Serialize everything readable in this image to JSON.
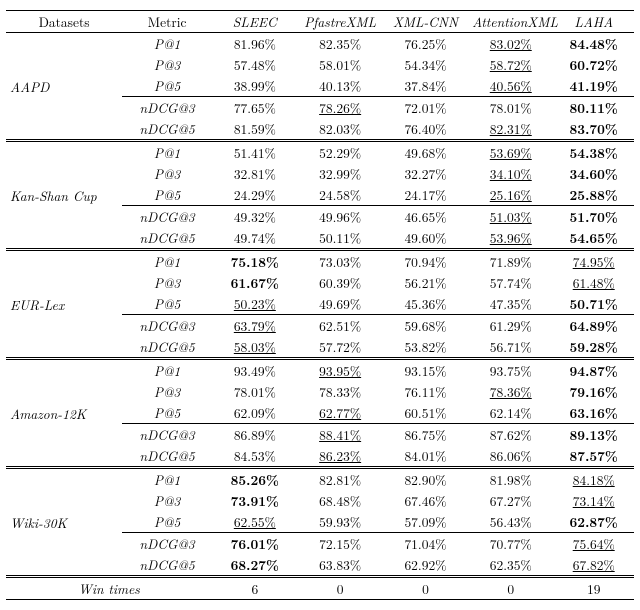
{
  "columns": {
    "datasets": "Datasets",
    "metric": "Metric",
    "models": [
      "SLEEC",
      "PfastreXML",
      "XML-CNN",
      "AttentionXML",
      "LAHA"
    ]
  },
  "footer": {
    "label": "Win times",
    "values": [
      "6",
      "0",
      "0",
      "0",
      "19"
    ]
  },
  "blocks": [
    {
      "dataset": "AAPD",
      "rows": [
        {
          "metric": "P@1",
          "cells": [
            {
              "v": "81.96%"
            },
            {
              "v": "82.35%"
            },
            {
              "v": "76.25%"
            },
            {
              "v": "83.02%",
              "u": true
            },
            {
              "v": "84.48%",
              "b": true
            }
          ]
        },
        {
          "metric": "P@3",
          "cells": [
            {
              "v": "57.48%"
            },
            {
              "v": "58.01%"
            },
            {
              "v": "54.34%"
            },
            {
              "v": "58.72%",
              "u": true
            },
            {
              "v": "60.72%",
              "b": true
            }
          ]
        },
        {
          "metric": "P@5",
          "cells": [
            {
              "v": "38.99%"
            },
            {
              "v": "40.13%"
            },
            {
              "v": "37.84%"
            },
            {
              "v": "40.56%",
              "u": true
            },
            {
              "v": "41.19%",
              "b": true
            }
          ]
        },
        {
          "metric": "nDCG@3",
          "sep": true,
          "cells": [
            {
              "v": "77.65%"
            },
            {
              "v": "78.26%",
              "u": true
            },
            {
              "v": "72.01%"
            },
            {
              "v": "78.01%"
            },
            {
              "v": "80.11%",
              "b": true
            }
          ]
        },
        {
          "metric": "nDCG@5",
          "cells": [
            {
              "v": "81.59%"
            },
            {
              "v": "82.03%"
            },
            {
              "v": "76.40%"
            },
            {
              "v": "82.31%",
              "u": true
            },
            {
              "v": "83.70%",
              "b": true
            }
          ]
        }
      ]
    },
    {
      "dataset": "Kan-Shan Cup",
      "rows": [
        {
          "metric": "P@1",
          "cells": [
            {
              "v": "51.41%"
            },
            {
              "v": "52.29%"
            },
            {
              "v": "49.68%"
            },
            {
              "v": "53.69%",
              "u": true
            },
            {
              "v": "54.38%",
              "b": true
            }
          ]
        },
        {
          "metric": "P@3",
          "cells": [
            {
              "v": "32.81%"
            },
            {
              "v": "32.99%"
            },
            {
              "v": "32.27%"
            },
            {
              "v": "34.10%",
              "u": true
            },
            {
              "v": "34.60%",
              "b": true
            }
          ]
        },
        {
          "metric": "P@5",
          "cells": [
            {
              "v": "24.29%"
            },
            {
              "v": "24.58%"
            },
            {
              "v": "24.17%"
            },
            {
              "v": "25.16%",
              "u": true
            },
            {
              "v": "25.88%",
              "b": true
            }
          ]
        },
        {
          "metric": "nDCG@3",
          "sep": true,
          "cells": [
            {
              "v": "49.32%"
            },
            {
              "v": "49.96%"
            },
            {
              "v": "46.65%"
            },
            {
              "v": "51.03%",
              "u": true
            },
            {
              "v": "51.70%",
              "b": true
            }
          ]
        },
        {
          "metric": "nDCG@5",
          "cells": [
            {
              "v": "49.74%"
            },
            {
              "v": "50.11%"
            },
            {
              "v": "49.60%"
            },
            {
              "v": "53.96%",
              "u": true
            },
            {
              "v": "54.65%",
              "b": true
            }
          ]
        }
      ]
    },
    {
      "dataset": "EUR-Lex",
      "rows": [
        {
          "metric": "P@1",
          "cells": [
            {
              "v": "75.18%",
              "b": true
            },
            {
              "v": "73.03%"
            },
            {
              "v": "70.94%"
            },
            {
              "v": "71.89%"
            },
            {
              "v": "74.95%",
              "u": true
            }
          ]
        },
        {
          "metric": "P@3",
          "cells": [
            {
              "v": "61.67%",
              "b": true
            },
            {
              "v": "60.39%"
            },
            {
              "v": "56.21%"
            },
            {
              "v": "57.74%"
            },
            {
              "v": "61.48%",
              "u": true
            }
          ]
        },
        {
          "metric": "P@5",
          "cells": [
            {
              "v": "50.23%",
              "u": true
            },
            {
              "v": "49.69%"
            },
            {
              "v": "45.36%"
            },
            {
              "v": "47.35%"
            },
            {
              "v": "50.71%",
              "b": true
            }
          ]
        },
        {
          "metric": "nDCG@3",
          "sep": true,
          "cells": [
            {
              "v": "63.79%",
              "u": true
            },
            {
              "v": "62.51%"
            },
            {
              "v": "59.68%"
            },
            {
              "v": "61.29%"
            },
            {
              "v": "64.89%",
              "b": true
            }
          ]
        },
        {
          "metric": "nDCG@5",
          "cells": [
            {
              "v": "58.03%",
              "u": true
            },
            {
              "v": "57.72%"
            },
            {
              "v": "53.82%"
            },
            {
              "v": "56.71%"
            },
            {
              "v": "59.28%",
              "b": true
            }
          ]
        }
      ]
    },
    {
      "dataset": "Amazon-12K",
      "rows": [
        {
          "metric": "P@1",
          "cells": [
            {
              "v": "93.49%"
            },
            {
              "v": "93.95%",
              "u": true
            },
            {
              "v": "93.15%"
            },
            {
              "v": "93.75%"
            },
            {
              "v": "94.87%",
              "b": true
            }
          ]
        },
        {
          "metric": "P@3",
          "cells": [
            {
              "v": "78.01%"
            },
            {
              "v": "78.33%"
            },
            {
              "v": "76.11%"
            },
            {
              "v": "78.36%",
              "u": true
            },
            {
              "v": "79.16%",
              "b": true
            }
          ]
        },
        {
          "metric": "P@5",
          "cells": [
            {
              "v": "62.09%"
            },
            {
              "v": "62.77%",
              "u": true
            },
            {
              "v": "60.51%"
            },
            {
              "v": "62.14%"
            },
            {
              "v": "63.16%",
              "b": true
            }
          ]
        },
        {
          "metric": "nDCG@3",
          "sep": true,
          "cells": [
            {
              "v": "86.89%"
            },
            {
              "v": "88.41%",
              "u": true
            },
            {
              "v": "86.75%"
            },
            {
              "v": "87.62%"
            },
            {
              "v": "89.13%",
              "b": true
            }
          ]
        },
        {
          "metric": "nDCG@5",
          "cells": [
            {
              "v": "84.53%"
            },
            {
              "v": "86.23%",
              "u": true
            },
            {
              "v": "84.01%"
            },
            {
              "v": "86.06%"
            },
            {
              "v": "87.57%",
              "b": true
            }
          ]
        }
      ]
    },
    {
      "dataset": "Wiki-30K",
      "rows": [
        {
          "metric": "P@1",
          "cells": [
            {
              "v": "85.26%",
              "b": true
            },
            {
              "v": "82.81%"
            },
            {
              "v": "82.90%"
            },
            {
              "v": "81.98%"
            },
            {
              "v": "84.18%",
              "u": true
            }
          ]
        },
        {
          "metric": "P@3",
          "cells": [
            {
              "v": "73.91%",
              "b": true
            },
            {
              "v": "68.48%"
            },
            {
              "v": "67.46%"
            },
            {
              "v": "67.27%"
            },
            {
              "v": "73.14%",
              "u": true
            }
          ]
        },
        {
          "metric": "P@5",
          "cells": [
            {
              "v": "62.55%",
              "u": true
            },
            {
              "v": "59.93%"
            },
            {
              "v": "57.09%"
            },
            {
              "v": "56.43%"
            },
            {
              "v": "62.87%",
              "b": true
            }
          ]
        },
        {
          "metric": "nDCG@3",
          "sep": true,
          "cells": [
            {
              "v": "76.01%",
              "b": true
            },
            {
              "v": "72.15%"
            },
            {
              "v": "71.04%"
            },
            {
              "v": "70.77%"
            },
            {
              "v": "75.64%",
              "u": true
            }
          ]
        },
        {
          "metric": "nDCG@5",
          "cells": [
            {
              "v": "68.27%",
              "b": true
            },
            {
              "v": "63.83%"
            },
            {
              "v": "62.92%"
            },
            {
              "v": "62.35%"
            },
            {
              "v": "67.82%",
              "u": true
            }
          ]
        }
      ]
    }
  ]
}
